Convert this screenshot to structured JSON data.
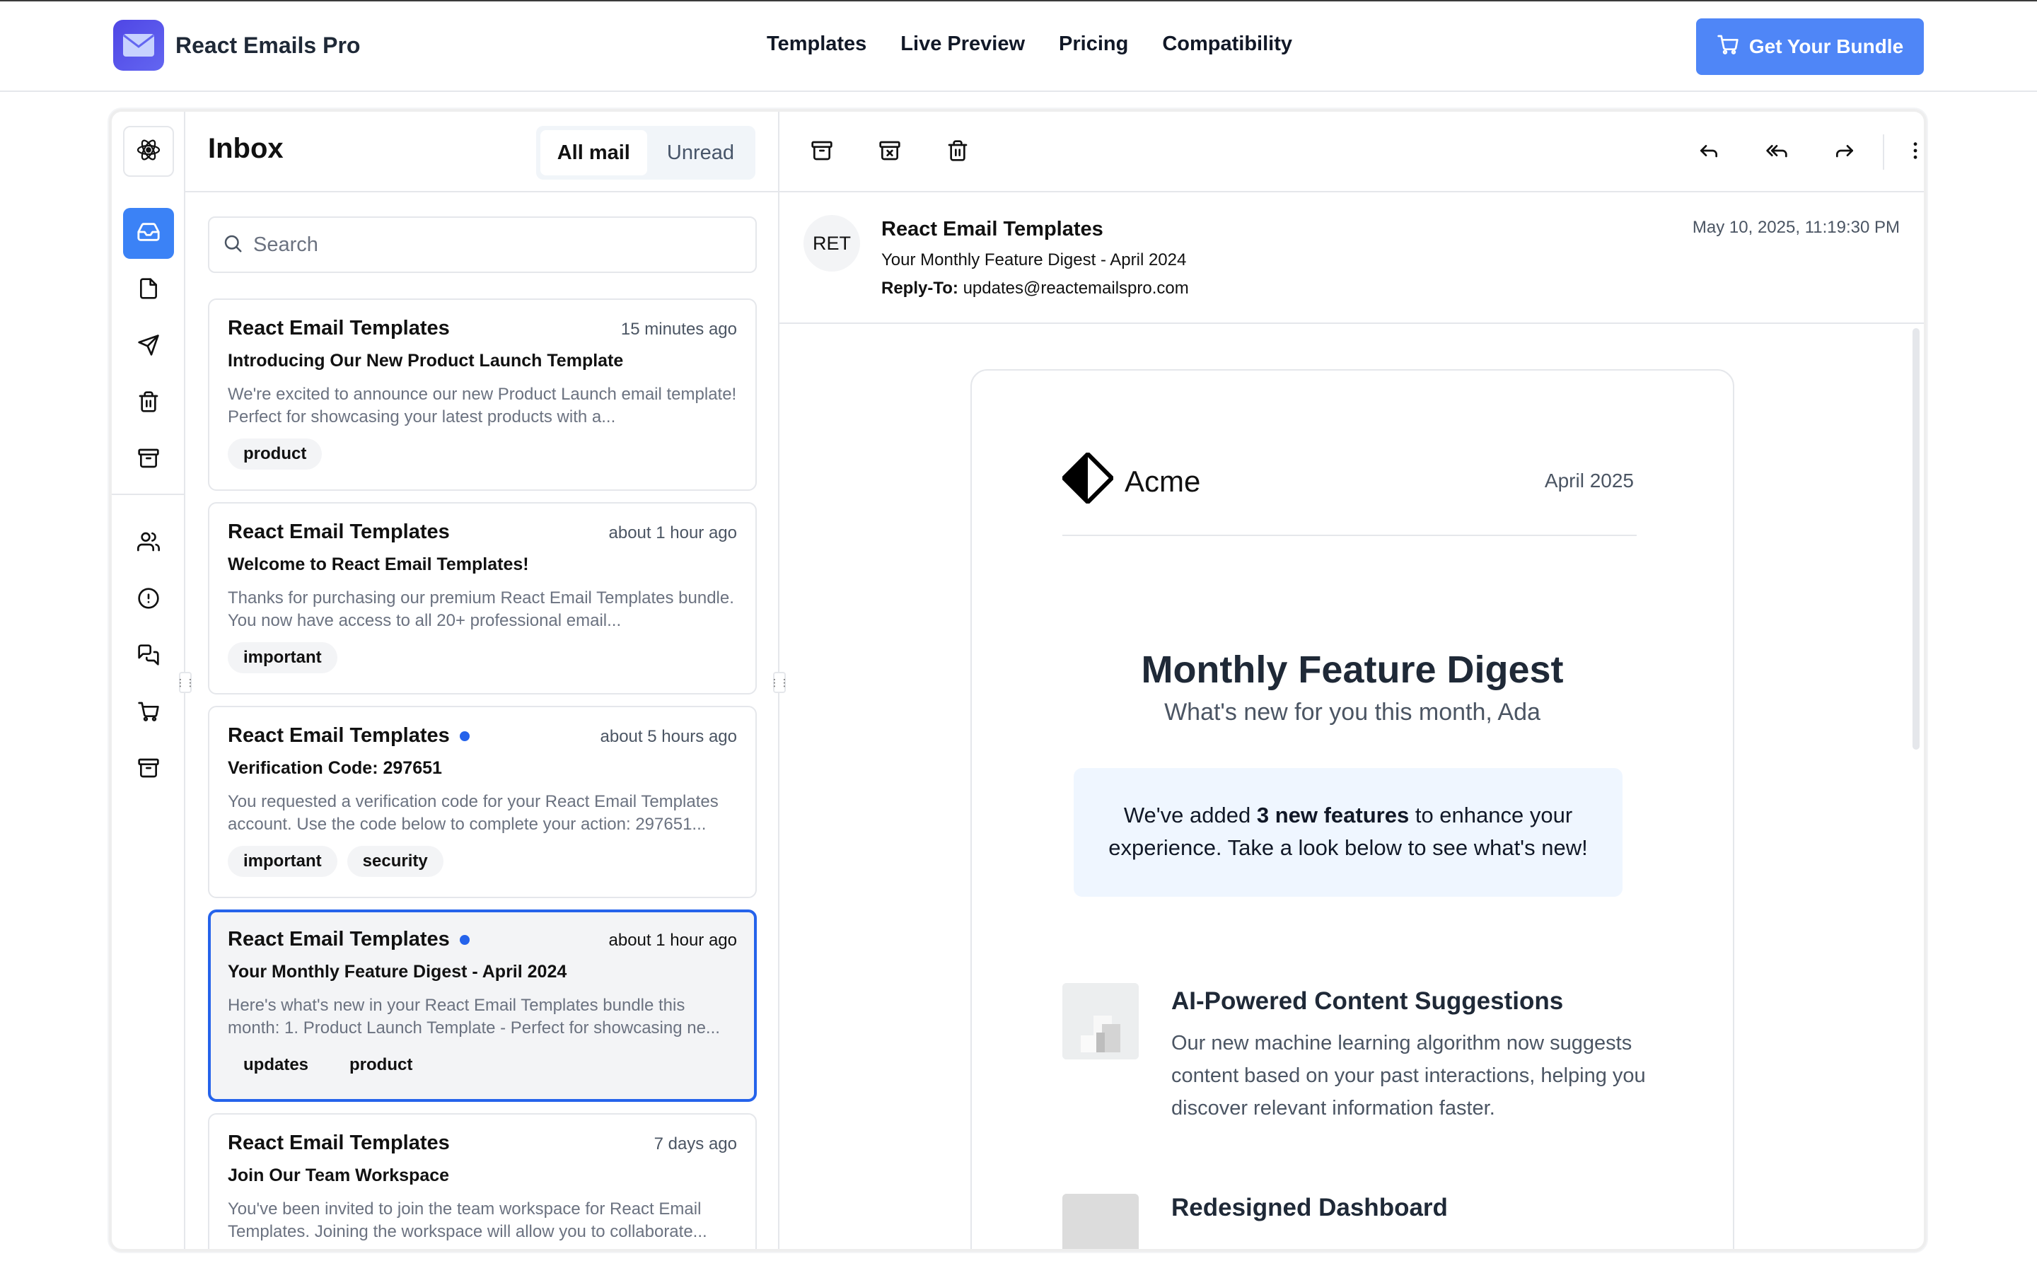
{
  "brand": {
    "name": "React Emails Pro"
  },
  "nav": {
    "links": [
      "Templates",
      "Live Preview",
      "Pricing",
      "Compatibility"
    ],
    "cta": "Get Your Bundle"
  },
  "colors": {
    "accent": "#4f86f7",
    "selected_border": "#2563eb",
    "rail_active": "#3b82f6",
    "unread_dot": "#2563eb"
  },
  "sidebar": {
    "icons": [
      "react-logo-icon",
      "inbox-icon",
      "file-icon",
      "send-icon",
      "trash-icon",
      "archive-icon",
      "users-icon",
      "alert-circle-icon",
      "messages-icon",
      "cart-icon",
      "archive-icon"
    ],
    "active": "inbox-icon"
  },
  "list": {
    "title": "Inbox",
    "filters": [
      "All mail",
      "Unread"
    ],
    "active_filter": "All mail",
    "search_placeholder": "Search",
    "emails": [
      {
        "from": "React Email Templates",
        "time": "15 minutes ago",
        "subject": "Introducing Our New Product Launch Template",
        "preview": "We're excited to announce our new Product Launch email template! Perfect for showcasing your latest products with a...",
        "tags": [
          "product"
        ],
        "unread": false,
        "selected": false
      },
      {
        "from": "React Email Templates",
        "time": "about 1 hour ago",
        "subject": "Welcome to React Email Templates!",
        "preview": "Thanks for purchasing our premium React Email Templates bundle. You now have access to all 20+ professional email...",
        "tags": [
          "important"
        ],
        "unread": false,
        "selected": false
      },
      {
        "from": "React Email Templates",
        "time": "about 5 hours ago",
        "subject": "Verification Code: 297651",
        "preview": "You requested a verification code for your React Email Templates account. Use the code below to complete your action: 297651...",
        "tags": [
          "important",
          "security"
        ],
        "unread": true,
        "selected": false
      },
      {
        "from": "React Email Templates",
        "time": "about 1 hour ago",
        "subject": "Your Monthly Feature Digest - April 2024",
        "preview": "Here's what's new in your React Email Templates bundle this month: 1. Product Launch Template - Perfect for showcasing ne...",
        "tags": [
          "updates",
          "product"
        ],
        "unread": true,
        "selected": true
      },
      {
        "from": "React Email Templates",
        "time": "7 days ago",
        "subject": "Join Our Team Workspace",
        "preview": "You've been invited to join the team workspace for React Email Templates. Joining the workspace will allow you to collaborate...",
        "tags": [],
        "unread": false,
        "selected": false
      }
    ]
  },
  "reader": {
    "toolbar_icons": [
      "archive-icon",
      "archive-x-icon",
      "trash-icon",
      "reply-icon",
      "reply-all-icon",
      "forward-icon",
      "more-vertical-icon"
    ],
    "avatar": "RET",
    "from": "React Email Templates",
    "subject": "Your Monthly Feature Digest - April 2024",
    "reply_to_label": "Reply-To:",
    "reply_to": "updates@reactemailspro.com",
    "date": "May 10, 2025, 11:19:30 PM"
  },
  "email": {
    "company": "Acme",
    "date": "April 2025",
    "title": "Monthly Feature Digest",
    "subtitle": "What's new for you this month, Ada",
    "callout_pre": "We've added ",
    "callout_bold": "3 new features",
    "callout_post": " to enhance your experience. Take a look below to see what's new!",
    "features": [
      {
        "title": "AI-Powered Content Suggestions",
        "desc": "Our new machine learning algorithm now suggests content based on your past interactions, helping you discover relevant information faster."
      },
      {
        "title": "Redesigned Dashboard",
        "desc": ""
      }
    ]
  }
}
